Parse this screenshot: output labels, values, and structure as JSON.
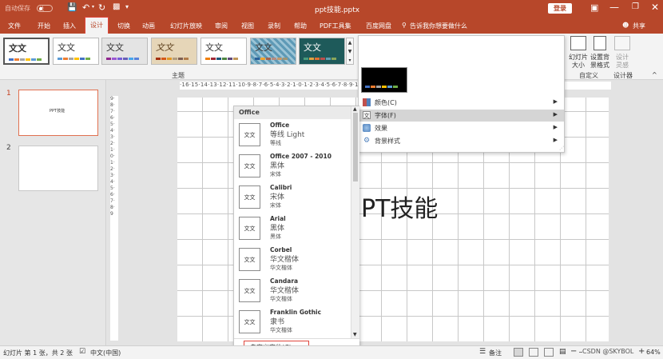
{
  "titlebar": {
    "autosave_label": "自动保存",
    "autosave_state": "关",
    "filename": "ppt技能.pptx",
    "login_label": "登录"
  },
  "menu": {
    "items": [
      "文件",
      "开始",
      "插入",
      "设计",
      "切换",
      "动画",
      "幻灯片放映",
      "审阅",
      "视图",
      "录制",
      "帮助",
      "PDF工具集",
      "百度网盘"
    ],
    "tell_me": "告诉我你想要做什么",
    "share": "共享"
  },
  "ribbon": {
    "themes_label": "主题",
    "theme_sample": "文文",
    "customize_label": "自定义",
    "designer_label": "设计器",
    "slide_size": "幻灯片 大小",
    "format_bg": "设置背 景格式",
    "design_ideas": "设计 灵感"
  },
  "variant_menu": {
    "items": [
      {
        "label": "颜色(C)",
        "icon": "palette-icon"
      },
      {
        "label": "字体(F)",
        "icon": "font-icon",
        "highlighted": true
      },
      {
        "label": "效果",
        "icon": "effects-icon"
      },
      {
        "label": "背景样式",
        "icon": "background-icon"
      }
    ]
  },
  "font_list": {
    "header": "Office",
    "icon_text": "文文",
    "items": [
      {
        "name": "Office",
        "heading": "等线 Light",
        "body": "等线"
      },
      {
        "name": "Office 2007 - 2010",
        "heading": "黑体",
        "body": "宋体"
      },
      {
        "name": "Calibri",
        "heading": "宋体",
        "body": "宋体"
      },
      {
        "name": "Arial",
        "heading": "黑体",
        "body": "黑体"
      },
      {
        "name": "Corbel",
        "heading": "华文楷体",
        "body": "华文楷体"
      },
      {
        "name": "Candara",
        "heading": "华文楷体",
        "body": "华文楷体"
      },
      {
        "name": "Franklin Gothic",
        "heading": "隶书",
        "body": "华文楷体"
      }
    ],
    "customize_label": "自定义字体(C)..."
  },
  "slides": {
    "thumb_1_title": "PPT技能",
    "numbers": [
      "1",
      "2"
    ]
  },
  "canvas": {
    "title_text": "PT技能",
    "ruler_h": "·16·15·14·13·12·11·10·9·8·7·6·5·4·3·2·1·0·1·2·3·4·5·6·7·8·9·10·11·12·13·14·15·16·",
    "ruler_v": "9·8·7·6·5·4·3·2·1·0·1·2·3·4·5·6·7·8·9"
  },
  "statusbar": {
    "slide_info": "幻灯片 第 1 张，共 2 张",
    "language": "中文(中国)",
    "notes": "备注",
    "zoom": "64%",
    "watermark": "CSDN @SKYBOL"
  },
  "colors": {
    "brand": "#b7472a",
    "highlight_outline": "#e0463c"
  }
}
